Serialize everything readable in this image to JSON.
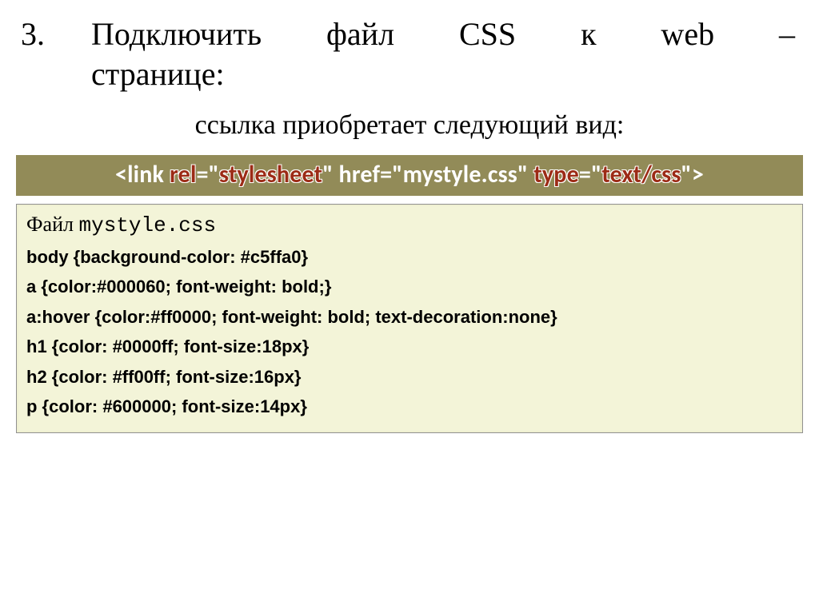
{
  "list_number": "3.",
  "heading_line1": "Подключить файл CSS к web –",
  "heading_line2": "странице:",
  "subtext": "ссылка приобретает следующий вид:",
  "banner": {
    "t1": "<link ",
    "hl_rel": "rel",
    "t2": "=\"",
    "hl_stylesheet": "stylesheet",
    "t3": "\" href=\"mystyle.css\" ",
    "hl_type": "type",
    "t4": "=\"",
    "hl_textcss": "text/css",
    "t5": "\">"
  },
  "file_label_prefix": "Файл ",
  "file_label_name": "mystyle.css",
  "css_rules": [
    "body {background-color: #c5ffa0}",
    "a {color:#000060; font-weight: bold;}",
    "a:hover {color:#ff0000; font-weight: bold; text-decoration:none}",
    "h1 {color: #0000ff; font-size:18px}",
    "h2 {color: #ff00ff; font-size:16px}",
    "p {color: #600000; font-size:14px}"
  ]
}
